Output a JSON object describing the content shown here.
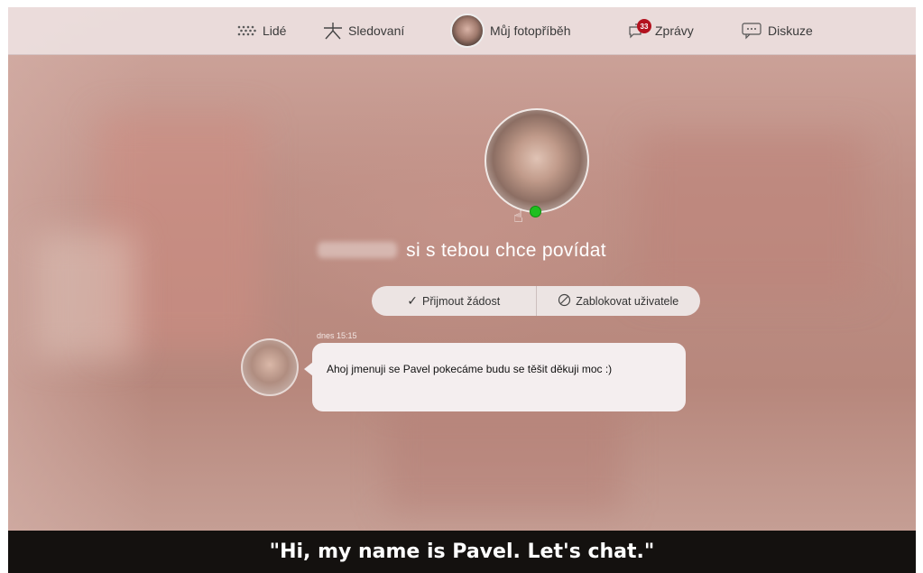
{
  "nav": {
    "items": [
      {
        "label": "Lidé",
        "icon": "people-dots-icon"
      },
      {
        "label": "Sledovaní",
        "icon": "star-icon"
      },
      {
        "label": "Můj fotopříběh",
        "icon": "avatar"
      },
      {
        "label": "Zprávy",
        "icon": "speech-bubbles-icon",
        "badge": "33"
      },
      {
        "label": "Diskuze",
        "icon": "comment-icon"
      }
    ]
  },
  "request": {
    "text": "si s tebou chce povídat"
  },
  "actions": {
    "accept_label": "Přijmout žádost",
    "block_label": "Zablokovat uživatele"
  },
  "message": {
    "time": "dnes 15:15",
    "text": "Ahoj jmenuji se Pavel pokecáme budu se těšit děkuji moc :)"
  },
  "caption": {
    "text": "\"Hi, my name is Pavel. Let's chat.\""
  },
  "colors": {
    "online": "#1fbf1f",
    "badge": "#b3121f",
    "caption_bg": "#14110f"
  }
}
